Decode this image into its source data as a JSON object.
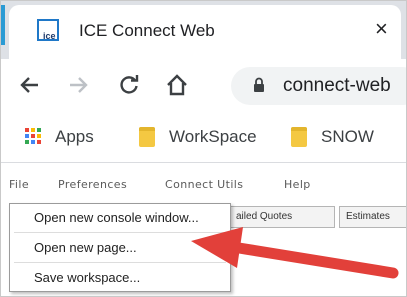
{
  "browser": {
    "tab": {
      "title": "ICE Connect Web",
      "favicon_text": "ice",
      "close_glyph": "×"
    },
    "toolbar": {
      "back_icon": "back-arrow-icon",
      "forward_icon": "forward-arrow-icon",
      "reload_icon": "reload-icon",
      "home_icon": "home-icon",
      "url": "connect-web"
    },
    "bookmarks": [
      {
        "label": "Apps",
        "icon": "apps-grid-icon"
      },
      {
        "label": "WorkSpace",
        "icon": "folder-icon"
      },
      {
        "label": "SNOW",
        "icon": "folder-icon"
      }
    ]
  },
  "app": {
    "menubar": [
      "File",
      "Preferences",
      "Connect Utils",
      "Help"
    ],
    "tabs": [
      "ailed Quotes",
      "Estimates"
    ],
    "file_menu": [
      "Open new console window...",
      "Open new page...",
      "Save workspace..."
    ]
  },
  "colors": {
    "tab_accent": "#2b9bd4",
    "arrow": "#e2403a",
    "folder": "#f4c842"
  }
}
